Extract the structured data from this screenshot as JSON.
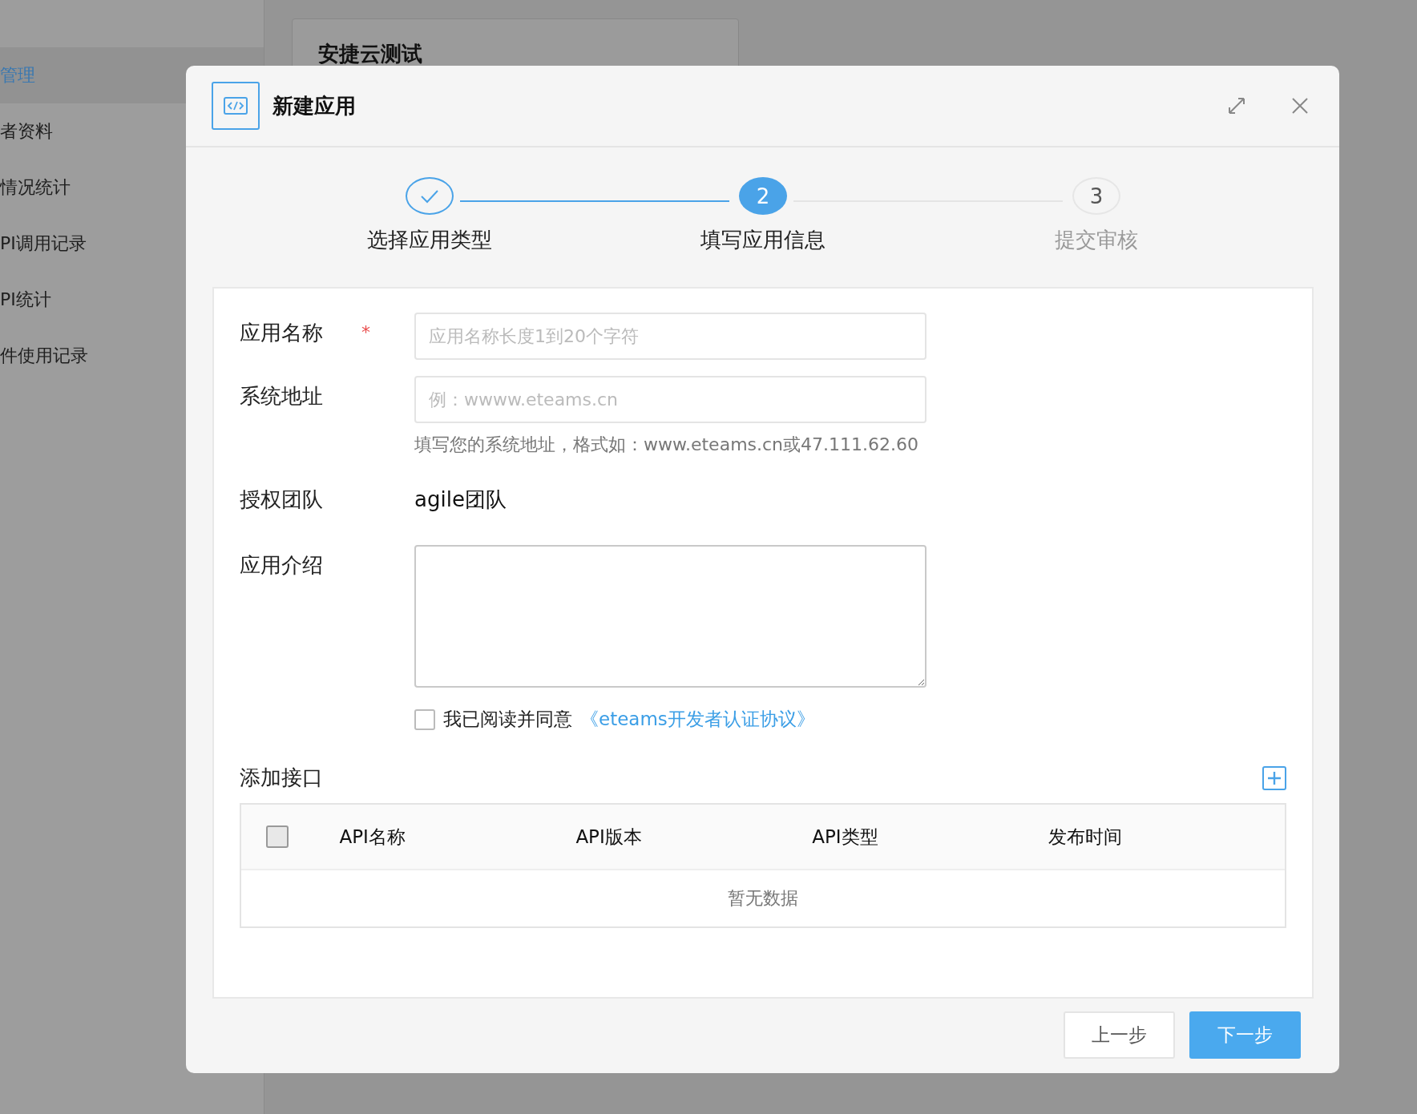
{
  "sidebar": {
    "items": [
      {
        "label": "管理",
        "selected": true
      },
      {
        "label": "者资料",
        "selected": false
      },
      {
        "label": "情况统计",
        "selected": false
      },
      {
        "label": "PI调用记录",
        "selected": false
      },
      {
        "label": "PI统计",
        "selected": false
      },
      {
        "label": "件使用记录",
        "selected": false
      }
    ]
  },
  "background_card": {
    "title": "安捷云测试"
  },
  "dialog": {
    "title": "新建应用",
    "steps": [
      {
        "done": true,
        "selected": false,
        "label": "选择应用类型"
      },
      {
        "done": false,
        "selected": true,
        "number": "2",
        "label": "填写应用信息"
      },
      {
        "done": false,
        "selected": false,
        "number": "3",
        "label": "提交审核"
      }
    ],
    "fields": [
      {
        "kind": "input",
        "label": "应用名称",
        "required_mark": "*",
        "placeholder": "应用名称长度1到20个字符"
      },
      {
        "kind": "input",
        "label": "系统地址",
        "placeholder": "例：wwww.eteams.cn",
        "hint": "填写您的系统地址，格式如：www.eteams.cn或47.111.62.60"
      },
      {
        "kind": "text",
        "label": "授权团队",
        "value": "agile团队"
      },
      {
        "kind": "textarea",
        "label": "应用介绍"
      }
    ],
    "agreement": {
      "checked": false,
      "text": "我已阅读并同意",
      "link": "《eteams开发者认证协议》"
    },
    "api_section": {
      "title": "添加接口",
      "columns": [
        "API名称",
        "API版本",
        "API类型",
        "发布时间"
      ],
      "select_all": false,
      "empty_text": "暂无数据"
    },
    "buttons": [
      {
        "label": "上一步",
        "kind": "secondary"
      },
      {
        "label": "下一步",
        "kind": "primary"
      }
    ]
  }
}
